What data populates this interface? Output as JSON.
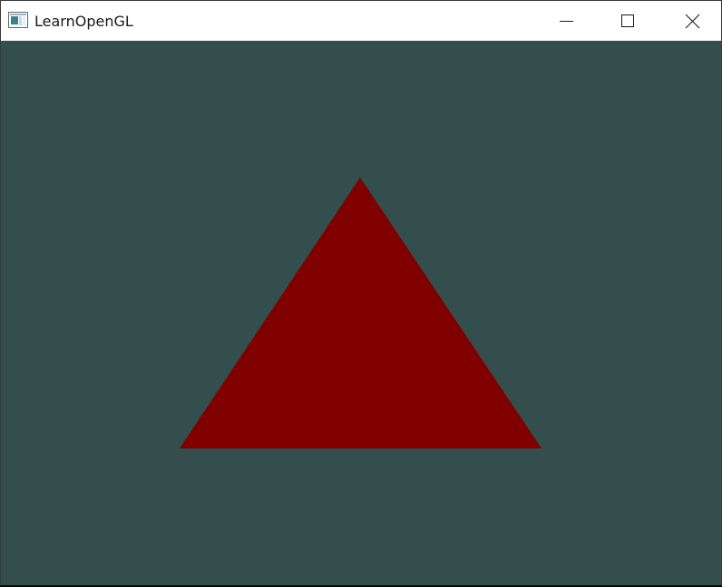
{
  "window": {
    "title": "LearnOpenGL",
    "app_icon": "window-app-icon",
    "controls": {
      "minimize_icon": "minimize-icon",
      "maximize_icon": "maximize-icon",
      "close_icon": "close-icon"
    }
  },
  "scene": {
    "clear_color": "#344d4d",
    "triangle_color": "#800000",
    "shape": "triangle"
  }
}
